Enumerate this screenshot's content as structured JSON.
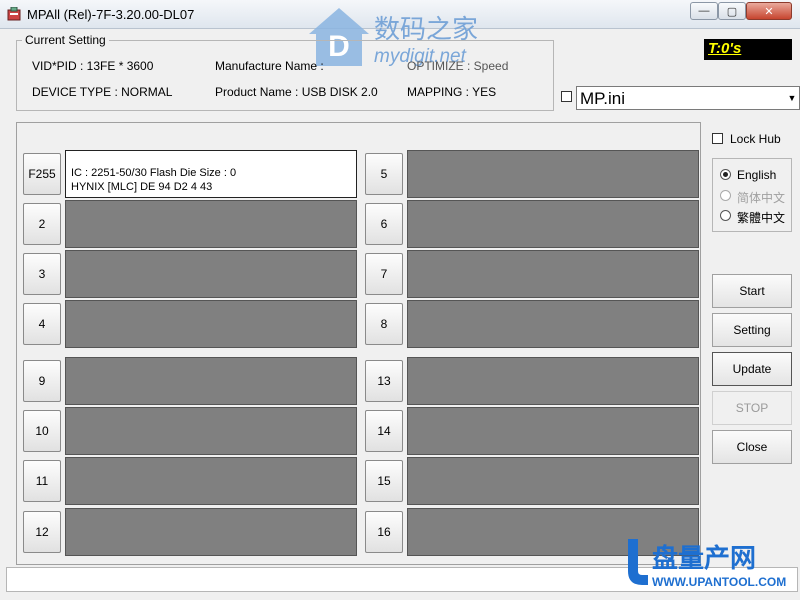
{
  "window": {
    "title": "MPAll (Rel)-7F-3.20.00-DL07",
    "min_glyph": "—",
    "max_glyph": "▢",
    "close_glyph": "✕"
  },
  "watermark_top": {
    "cn": "数码之家",
    "url": "mydigit.net"
  },
  "current_setting": {
    "legend": "Current Setting",
    "vid_pid": "VID*PID : 13FE * 3600",
    "device_type": "DEVICE TYPE : NORMAL",
    "manufacture_name": "Manufacture Name :",
    "product_name": "Product Name : USB DISK 2.0",
    "optimize": "OPTIMIZE : Speed",
    "mapping": "MAPPING : YES"
  },
  "timer": "T:0's",
  "ini": {
    "checked": false,
    "value": "MP.ini"
  },
  "ports": [
    {
      "label": "F255",
      "active": true,
      "line1": "IC : 2251-50/30  Flash Die Size : 0",
      "line2": "HYNIX [MLC] DE 94 D2 4 43"
    },
    {
      "label": "2",
      "active": false
    },
    {
      "label": "3",
      "active": false
    },
    {
      "label": "4",
      "active": false
    },
    {
      "label": "5",
      "active": false
    },
    {
      "label": "6",
      "active": false
    },
    {
      "label": "7",
      "active": false
    },
    {
      "label": "8",
      "active": false
    },
    {
      "label": "9",
      "active": false
    },
    {
      "label": "10",
      "active": false
    },
    {
      "label": "11",
      "active": false
    },
    {
      "label": "12",
      "active": false
    },
    {
      "label": "13",
      "active": false
    },
    {
      "label": "14",
      "active": false
    },
    {
      "label": "15",
      "active": false
    },
    {
      "label": "16",
      "active": false
    }
  ],
  "lock_hub": {
    "label": "Lock Hub",
    "checked": false
  },
  "languages": [
    {
      "label": "English",
      "selected": true,
      "enabled": true
    },
    {
      "label": "简体中文",
      "selected": false,
      "enabled": false
    },
    {
      "label": "繁體中文",
      "selected": false,
      "enabled": true
    }
  ],
  "buttons": {
    "start": "Start",
    "setting": "Setting",
    "update": "Update",
    "stop": "STOP",
    "close": "Close"
  },
  "watermark_bottom": {
    "cn": "盘量产网",
    "url": "WWW.UPANTOOL.COM"
  },
  "colors": {
    "empty_port": "#808080",
    "timer_text": "#ffff00",
    "timer_bg": "#000000"
  }
}
